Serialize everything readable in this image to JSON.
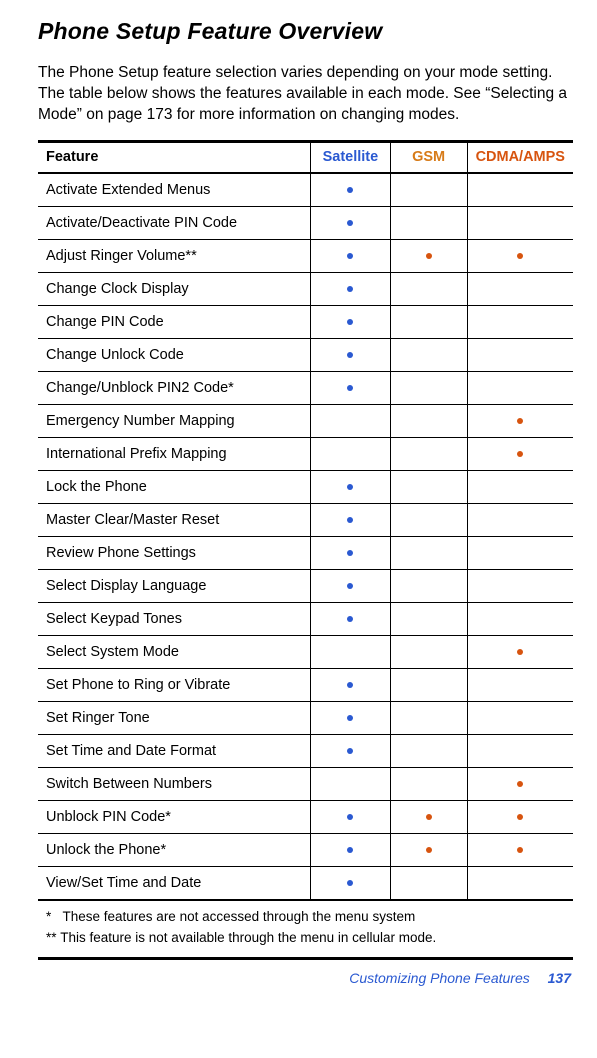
{
  "title": "Phone Setup Feature Overview",
  "intro": "The Phone Setup feature selection varies depending on your mode setting. The table below shows the features available in each mode. See “Selecting a Mode” on page 173 for more information on changing modes.",
  "headers": {
    "feature": "Feature",
    "satellite": "Satellite",
    "gsm": "GSM",
    "cdma": "CDMA/AMPS"
  },
  "rows": [
    {
      "feature": "Activate Extended Menus",
      "sat": true,
      "gsm": false,
      "cdma": false
    },
    {
      "feature": "Activate/Deactivate PIN Code",
      "sat": true,
      "gsm": false,
      "cdma": false
    },
    {
      "feature": "Adjust Ringer Volume**",
      "sat": true,
      "gsm": true,
      "cdma": true
    },
    {
      "feature": "Change Clock Display",
      "sat": true,
      "gsm": false,
      "cdma": false
    },
    {
      "feature": "Change PIN Code",
      "sat": true,
      "gsm": false,
      "cdma": false
    },
    {
      "feature": "Change Unlock Code",
      "sat": true,
      "gsm": false,
      "cdma": false
    },
    {
      "feature": "Change/Unblock PIN2 Code*",
      "sat": true,
      "gsm": false,
      "cdma": false
    },
    {
      "feature": "Emergency Number Mapping",
      "sat": false,
      "gsm": false,
      "cdma": true
    },
    {
      "feature": "International Prefix Mapping",
      "sat": false,
      "gsm": false,
      "cdma": true
    },
    {
      "feature": "Lock the Phone",
      "sat": true,
      "gsm": false,
      "cdma": false
    },
    {
      "feature": "Master Clear/Master Reset",
      "sat": true,
      "gsm": false,
      "cdma": false
    },
    {
      "feature": "Review Phone Settings",
      "sat": true,
      "gsm": false,
      "cdma": false
    },
    {
      "feature": "Select Display Language",
      "sat": true,
      "gsm": false,
      "cdma": false
    },
    {
      "feature": "Select Keypad Tones",
      "sat": true,
      "gsm": false,
      "cdma": false
    },
    {
      "feature": "Select System Mode",
      "sat": false,
      "gsm": false,
      "cdma": true
    },
    {
      "feature": "Set Phone to Ring or Vibrate",
      "sat": true,
      "gsm": false,
      "cdma": false
    },
    {
      "feature": "Set Ringer Tone",
      "sat": true,
      "gsm": false,
      "cdma": false
    },
    {
      "feature": "Set Time and Date Format",
      "sat": true,
      "gsm": false,
      "cdma": false
    },
    {
      "feature": "Switch Between Numbers",
      "sat": false,
      "gsm": false,
      "cdma": true
    },
    {
      "feature": "Unblock PIN Code*",
      "sat": true,
      "gsm": true,
      "cdma": true
    },
    {
      "feature": "Unlock the Phone*",
      "sat": true,
      "gsm": true,
      "cdma": true
    },
    {
      "feature": "View/Set Time and Date",
      "sat": true,
      "gsm": false,
      "cdma": false
    }
  ],
  "note1": "*   These features are not accessed through the menu system",
  "note2": "** This feature is not available through the menu in cellular mode.",
  "footer_text": "Customizing Phone Features",
  "footer_page": "137"
}
